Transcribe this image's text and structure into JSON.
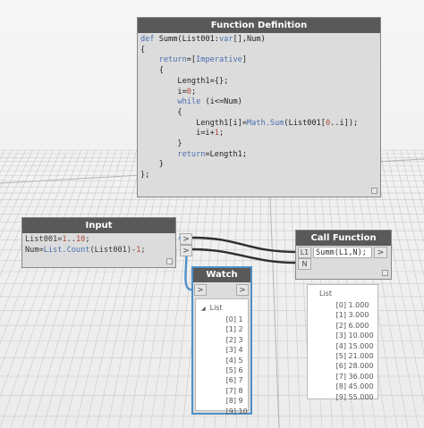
{
  "function_definition": {
    "title": "Function Definition",
    "code_lines": [
      "def Summ(List001:var[],Num)",
      "{",
      "    return=[Imperative]",
      "    {",
      "        Length1={};",
      "        i=0;",
      "        while (i<=Num)",
      "        {",
      "            Length1[i]=Math.Sum(List001[0..i]);",
      "            i=i+1;",
      "        }",
      "        return=Length1;",
      "    }",
      "};"
    ]
  },
  "input_node": {
    "title": "Input",
    "lines": [
      "List001=1..10;",
      "Num=List.Count(List001)-1;"
    ],
    "output_arrow": ">"
  },
  "call_function": {
    "title": "Call Function",
    "inputs": [
      "L1",
      "N"
    ],
    "expression": "Summ(L1,N);",
    "output_arrow": ">"
  },
  "watch_node": {
    "title": "Watch",
    "input_arrow": ">",
    "output_arrow": ">",
    "list_label": "List",
    "items": [
      {
        "index": "[0]",
        "value": "1"
      },
      {
        "index": "[1]",
        "value": "2"
      },
      {
        "index": "[2]",
        "value": "3"
      },
      {
        "index": "[3]",
        "value": "4"
      },
      {
        "index": "[4]",
        "value": "5"
      },
      {
        "index": "[5]",
        "value": "6"
      },
      {
        "index": "[6]",
        "value": "7"
      },
      {
        "index": "[7]",
        "value": "8"
      },
      {
        "index": "[8]",
        "value": "9"
      },
      {
        "index": "[9]",
        "value": "10"
      }
    ]
  },
  "result_preview": {
    "list_label": "List",
    "items": [
      {
        "index": "[0]",
        "value": "1.000"
      },
      {
        "index": "[1]",
        "value": "3.000"
      },
      {
        "index": "[2]",
        "value": "6.000"
      },
      {
        "index": "[3]",
        "value": "10.000"
      },
      {
        "index": "[4]",
        "value": "15.000"
      },
      {
        "index": "[5]",
        "value": "21.000"
      },
      {
        "index": "[6]",
        "value": "28.000"
      },
      {
        "index": "[7]",
        "value": "36.000"
      },
      {
        "index": "[8]",
        "value": "45.000"
      },
      {
        "index": "[9]",
        "value": "55.000"
      }
    ]
  },
  "colors": {
    "node_header": "#595959",
    "selected_border": "#4f90c8",
    "wire_dark": "#2e2e2e",
    "wire_blue": "#4f90c8",
    "keyword": "#4a6fb0",
    "number": "#b0453a"
  }
}
